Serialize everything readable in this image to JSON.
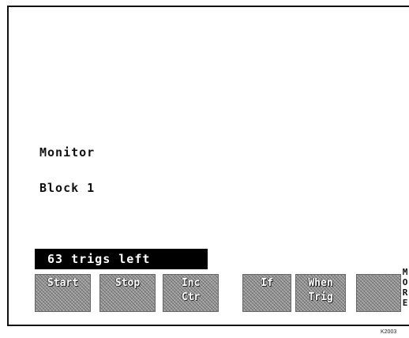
{
  "screen": {
    "monitor_label": "Monitor",
    "block_label": "Block 1",
    "status": "63 trigs left"
  },
  "softkeys": [
    {
      "line1": "Start",
      "line2": ""
    },
    {
      "line1": "Stop",
      "line2": ""
    },
    {
      "line1": "Inc",
      "line2": "Ctr"
    },
    {
      "line1": "If",
      "line2": ""
    },
    {
      "line1": "When",
      "line2": "Trig"
    },
    {
      "line1": "",
      "line2": ""
    }
  ],
  "more": [
    "M",
    "O",
    "R",
    "E"
  ],
  "figure_code": "K2003"
}
